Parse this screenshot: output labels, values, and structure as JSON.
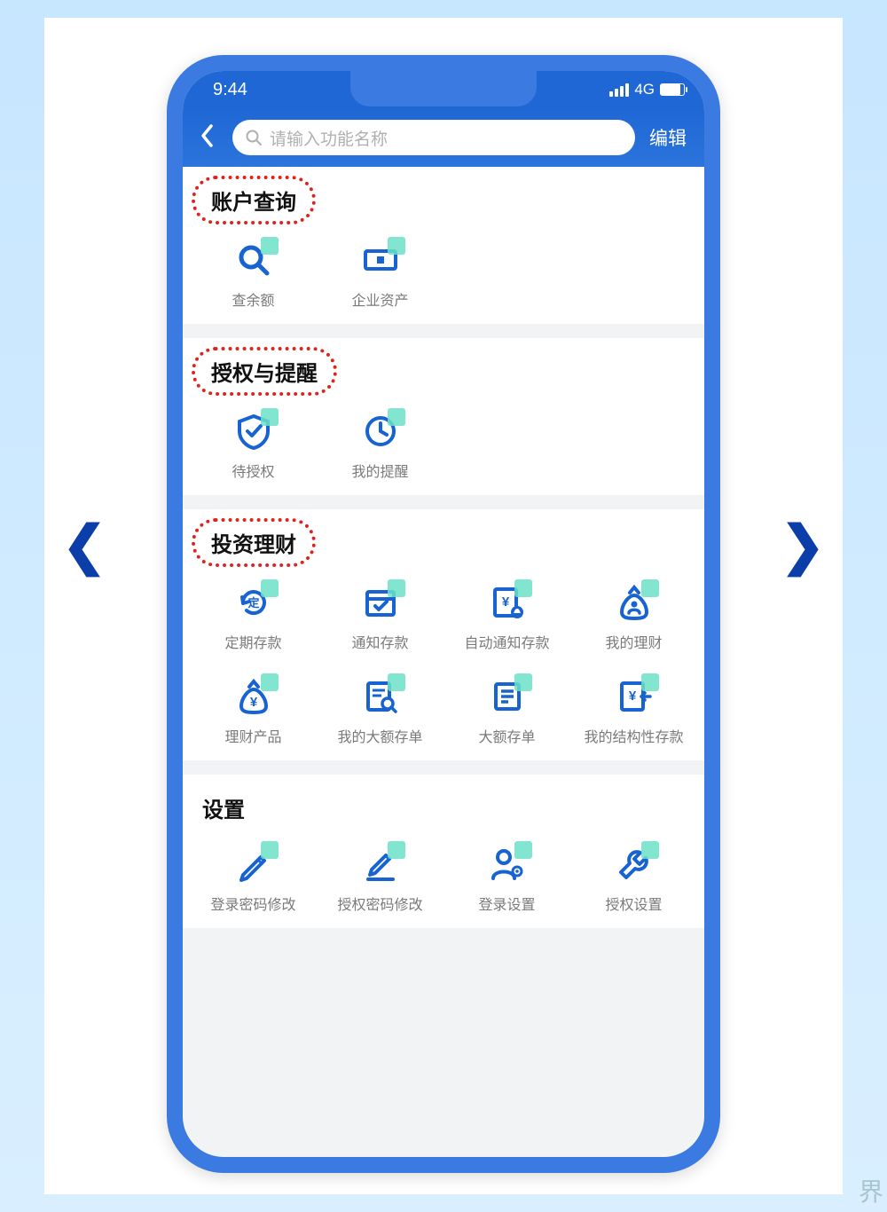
{
  "statusbar": {
    "time": "9:44",
    "net": "4G"
  },
  "navbar": {
    "search_placeholder": "请输入功能名称",
    "edit": "编辑"
  },
  "sections": [
    {
      "title": "账户查询",
      "highlighted": true,
      "items": [
        {
          "icon": "magnifier",
          "label": "查余额"
        },
        {
          "icon": "ticket",
          "label": "企业资产"
        }
      ]
    },
    {
      "title": "授权与提醒",
      "highlighted": true,
      "items": [
        {
          "icon": "shield-check",
          "label": "待授权"
        },
        {
          "icon": "clock",
          "label": "我的提醒"
        }
      ]
    },
    {
      "title": "投资理财",
      "highlighted": true,
      "items": [
        {
          "icon": "refresh-ding",
          "label": "定期存款"
        },
        {
          "icon": "calendar-check",
          "label": "通知存款"
        },
        {
          "icon": "doc-yen-bell",
          "label": "自动通知存款"
        },
        {
          "icon": "bag-person",
          "label": "我的理财"
        },
        {
          "icon": "bag-yen",
          "label": "理财产品"
        },
        {
          "icon": "doc-search",
          "label": "我的大额存单"
        },
        {
          "icon": "doc-lines",
          "label": "大额存单"
        },
        {
          "icon": "doc-yen-in",
          "label": "我的结构性存款"
        }
      ]
    },
    {
      "title": "设置",
      "highlighted": false,
      "items": [
        {
          "icon": "pencil",
          "label": "登录密码修改"
        },
        {
          "icon": "pencil-under",
          "label": "授权密码修改"
        },
        {
          "icon": "person-gear",
          "label": "登录设置"
        },
        {
          "icon": "wrench",
          "label": "授权设置"
        }
      ]
    }
  ],
  "colors": {
    "brand": "#1763d2",
    "accent": "#6be0c8",
    "highlight": "#e0221e"
  }
}
